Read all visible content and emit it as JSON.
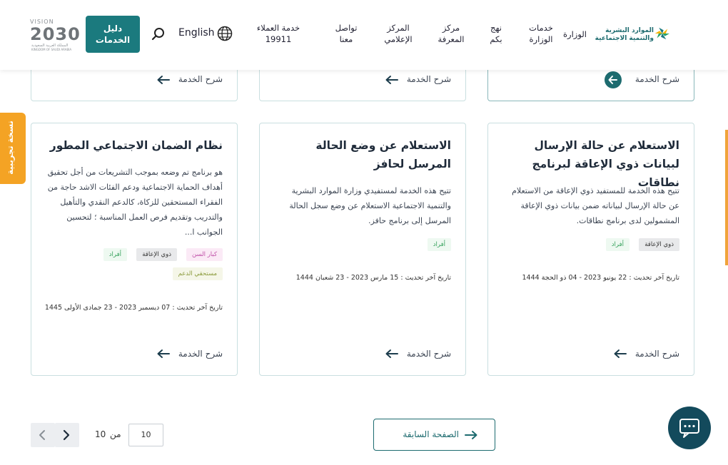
{
  "header": {
    "logo_line1": "الموارد البشرية",
    "logo_line2": "والتنمية الاجتماعية",
    "nav": [
      {
        "label": "الوزارة"
      },
      {
        "label": "خدمات الوزارة"
      },
      {
        "label": "نهج بكم"
      },
      {
        "label": "مركز المعرفة"
      },
      {
        "label": "المركز الإعلامي"
      },
      {
        "label": "تواصل معنا"
      },
      {
        "label": "خدمة العملاء 19911"
      }
    ],
    "language": "English",
    "guide_button": "دليل الخدمات",
    "vision_text": "VISION",
    "vision_year": "2030",
    "vision_sub": "المملكة العربية السعودية",
    "vision_sub_en": "KINGDOM OF SAUDI ARABIA"
  },
  "trial_tab": "نسخة تجريبية",
  "top_cards": [
    {
      "explain": "شرح الخدمة"
    },
    {
      "explain": "شرح الخدمة"
    },
    {
      "explain": "شرح الخدمة"
    }
  ],
  "cards": [
    {
      "title": "الاستعلام عن حالة الإرسال لبيانات ذوي الإعاقة لبرنامج نطاقات",
      "desc": "تتيح هذه الخدمة للمستفيد ذوي الإعاقة من الاستعلام عن حالة الإرسال لبياناته ضمن بيانات ذوي الإعاقة المشمولين لدى برنامج نطاقات.",
      "tags": [
        "ذوي الإعاقة",
        "أفراد"
      ],
      "date": "تاريخ آخر تحديث : 22 يونيو 2023 - 04 ذو الحجة 1444",
      "explain": "شرح الخدمة"
    },
    {
      "title": "الاستعلام عن وضع الحالة المرسل لحافز",
      "desc": "تتيح هذه الخدمة لمستفيدي وزارة الموارد البشرية والتنمية الاجتماعية الاستعلام عن وضع سجل الحالة المرسل إلى برنامج حافز.",
      "tags": [
        "أفراد"
      ],
      "date": "تاريخ آخر تحديث : 15 مارس 2023 - 23 شعبان 1444",
      "explain": "شرح الخدمة"
    },
    {
      "title": "نظام الضمان الاجتماعي المطور",
      "desc": "هو برنامج تم وضعه بموجب التشريعات من أجل تحقيق أهداف الحماية الاجتماعية ودعم الفئات الاشد حاجة من الفقراء المستحقين للزكاة، كالدعم النقدي والتأهيل والتدريب وتقديم فرص العمل المناسبة ؛ لتحسين الجوانب ا...",
      "tags": [
        "كبار السن",
        "ذوي الإعاقة",
        "أفراد",
        "مستحقي الدعم"
      ],
      "date": "تاريخ آخر تحديث : 07 ديسمبر 2023 - 23 جمادى الأولى 1445",
      "explain": "شرح الخدمة"
    }
  ],
  "pagination": {
    "prev_page": "الصفحة السابقة",
    "current": "10",
    "of": "من",
    "total": "10"
  },
  "colors": {
    "primary": "#1b7a7e",
    "accent": "#f4a324",
    "chat": "#134a5c"
  }
}
